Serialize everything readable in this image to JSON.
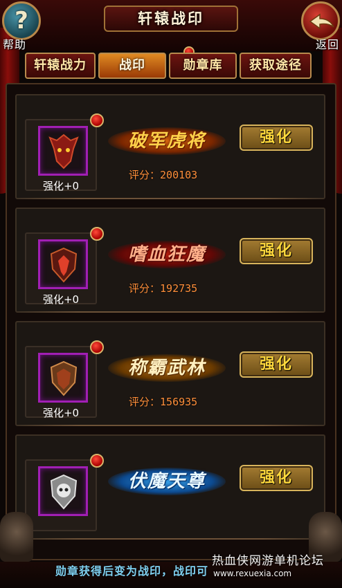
{
  "header": {
    "title": "轩辕战印",
    "help_label": "帮助",
    "back_label": "返回"
  },
  "tabs": [
    {
      "label": "轩辕战力",
      "active": false
    },
    {
      "label": "战印",
      "active": true
    },
    {
      "label": "勋章库",
      "active": false
    },
    {
      "label": "获取途径",
      "active": false
    }
  ],
  "seals": [
    {
      "title": "破军虎将",
      "level": "强化+0",
      "score_label": "评分：",
      "score": "200103",
      "button": "强化",
      "icon": "dragon-helm-icon",
      "title_color": "#ffc23a",
      "glow_color": "#b04a00"
    },
    {
      "title": "嗜血狂魔",
      "level": "强化+0",
      "score_label": "评分：",
      "score": "192735",
      "button": "强化",
      "icon": "demon-shield-icon",
      "title_color": "#ff6a4a",
      "glow_color": "#8a0c0c"
    },
    {
      "title": "称霸武林",
      "level": "强化+0",
      "score_label": "评分：",
      "score": "156935",
      "button": "强化",
      "icon": "bronze-shield-icon",
      "title_color": "#ffd87a",
      "glow_color": "#8a5400"
    },
    {
      "title": "伏魔天尊",
      "level": "",
      "score_label": "",
      "score": "",
      "button": "强化",
      "icon": "skull-shield-icon",
      "title_color": "#d8f4ff",
      "glow_color": "#1467b8"
    }
  ],
  "footer": {
    "tip": "勋章获得后变为战印，战印可",
    "watermark": "热血侠网游单机论坛",
    "watermark_url": "www.rexuexia.com"
  }
}
